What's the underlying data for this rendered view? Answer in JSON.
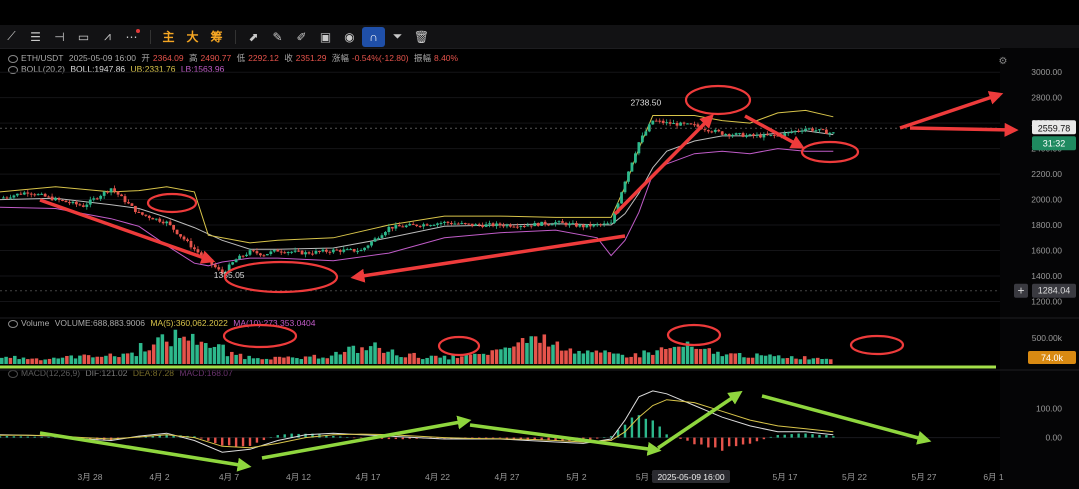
{
  "toolbar": {
    "items": [
      {
        "name": "trend-line-icon",
        "glyph": "⟋"
      },
      {
        "name": "parallel-lines-icon",
        "glyph": "☰"
      },
      {
        "name": "horizontal-line-icon",
        "glyph": "⊣"
      },
      {
        "name": "rectangle-icon",
        "glyph": "▭"
      },
      {
        "name": "fib-icon",
        "glyph": "⩘"
      },
      {
        "name": "more-icon",
        "glyph": "⋯"
      }
    ],
    "indicators": [
      "主",
      "大",
      "筹"
    ],
    "tools": [
      {
        "name": "pointer-icon",
        "glyph": "⬈"
      },
      {
        "name": "pencil-icon",
        "glyph": "✎"
      },
      {
        "name": "marker-icon",
        "glyph": "✐"
      },
      {
        "name": "clipboard-icon",
        "glyph": "▣"
      },
      {
        "name": "eye-icon",
        "glyph": "◉"
      },
      {
        "name": "magnet-icon",
        "glyph": "∩"
      },
      {
        "name": "filter-icon",
        "glyph": "⏷"
      },
      {
        "name": "trash-icon",
        "glyph": "🗑"
      }
    ]
  },
  "legend": {
    "symbol": "ETH/USDT",
    "datetime": "2025-05-09 16:00",
    "open_label": "开",
    "open": "2364.09",
    "high_label": "高",
    "high": "2490.77",
    "low_label": "低",
    "low": "2292.12",
    "close_label": "收",
    "close": "2351.29",
    "change_label": "涨幅",
    "change": "-0.54%(-12.80)",
    "amp_label": "振幅",
    "amp": "8.40%",
    "boll_name": "BOLL(20,2)",
    "boll": "BOLL:1947.86",
    "ub": "UB:2331.76",
    "lb": "LB:1563.96",
    "vol_name": "Volume",
    "vol": "VOLUME:688,883.9006",
    "ma5": "MA(5):360,062.2022",
    "ma10": "MA(10):273,353.0404",
    "macd_name": "MACD(12,26,9)",
    "dif": "DIF:121.02",
    "dea": "DEA:87.28",
    "macd": "MACD:168.07"
  },
  "colors": {
    "up": "#2db88c",
    "down": "#e5534b",
    "boll_mid": "#bbbbbb",
    "boll_ub": "#d8c44a",
    "boll_lb": "#c05cc8",
    "arrow_red": "#ee3b3b",
    "arrow_green": "#8fd63e",
    "vol_line": "#a4e04a"
  },
  "chart_data": [
    {
      "type": "line",
      "title": "ETH/USDT",
      "ylim": [
        1180,
        3080
      ],
      "y_ticks": [
        "3000.00",
        "2800.00",
        "2600.00",
        "2400.00",
        "2200.00",
        "2000.00",
        "1800.00",
        "1600.00",
        "1400.00",
        "1200.00"
      ],
      "y_tick_values": [
        3000,
        2800,
        2600,
        2400,
        2200,
        2000,
        1800,
        1600,
        1400,
        1200
      ],
      "x_ticks": [
        "3月 28",
        "4月 2",
        "4月 7",
        "4月 12",
        "4月 17",
        "4月 22",
        "4月 27",
        "5月 2",
        "5月 7",
        "5月 12",
        "5月 17",
        "5月 22",
        "5月 27",
        "6月 1"
      ],
      "series": [
        {
          "name": "price",
          "x": [
            0,
            2,
            4,
            6,
            8,
            10,
            12,
            14,
            16,
            17,
            18,
            19,
            20,
            22,
            24,
            26,
            28,
            30,
            32,
            34,
            36,
            38,
            40,
            42,
            44,
            45,
            46,
            47,
            48,
            50,
            52,
            54,
            56,
            58,
            60
          ],
          "values": [
            2010,
            2060,
            2000,
            1950,
            2090,
            1890,
            1820,
            1610,
            1420,
            1530,
            1590,
            1570,
            1600,
            1580,
            1600,
            1600,
            1780,
            1800,
            1820,
            1800,
            1800,
            1800,
            1820,
            1790,
            1810,
            2150,
            2450,
            2620,
            2600,
            2580,
            2520,
            2500,
            2500,
            2560,
            2520
          ]
        },
        {
          "name": "BOLL",
          "x": [
            0,
            4,
            8,
            10,
            12,
            14,
            16,
            18,
            20,
            24,
            28,
            32,
            36,
            40,
            44,
            45,
            46,
            47,
            48,
            50,
            52,
            54,
            56,
            58,
            60
          ],
          "values": [
            2000,
            2010,
            1960,
            1930,
            1860,
            1780,
            1680,
            1610,
            1610,
            1620,
            1700,
            1790,
            1800,
            1810,
            1800,
            1890,
            2050,
            2250,
            2380,
            2460,
            2500,
            2500,
            2520,
            2540,
            2510
          ]
        },
        {
          "name": "UB",
          "x": [
            0,
            4,
            8,
            10,
            12,
            14,
            15,
            16,
            18,
            20,
            24,
            28,
            32,
            36,
            40,
            44,
            45,
            46,
            47,
            48,
            50,
            52,
            54,
            56,
            58,
            60
          ],
          "values": [
            2060,
            2100,
            2060,
            2070,
            2100,
            2060,
            1720,
            1700,
            1660,
            1680,
            1700,
            1800,
            1870,
            1870,
            1860,
            1860,
            2100,
            2400,
            2660,
            2660,
            2660,
            2620,
            2600,
            2680,
            2700,
            2650
          ]
        },
        {
          "name": "LB",
          "x": [
            0,
            4,
            8,
            10,
            12,
            14,
            15,
            16,
            18,
            20,
            24,
            28,
            32,
            36,
            40,
            43,
            44,
            45,
            46,
            47,
            48,
            50,
            52,
            54,
            56,
            58,
            60
          ],
          "values": [
            1940,
            1930,
            1850,
            1790,
            1640,
            1500,
            1480,
            1510,
            1540,
            1540,
            1520,
            1580,
            1700,
            1740,
            1760,
            1700,
            1560,
            1680,
            1900,
            2200,
            2280,
            2360,
            2380,
            2360,
            2400,
            2380,
            2380
          ]
        }
      ],
      "annotations": [
        {
          "label": "2738.50",
          "x": 46.5,
          "y": 2738.5
        },
        {
          "label": "1385.05",
          "x": 16.5,
          "y": 1385.05
        }
      ],
      "price_tag": {
        "value": "2559.78",
        "timer": "31:32",
        "y": 2559.78
      },
      "hline_tag": {
        "value": "1284.04",
        "y": 1284.04
      }
    },
    {
      "type": "bar",
      "title": "Volume",
      "ylim": [
        0,
        700000
      ],
      "y_ticks": [
        "500.00k"
      ],
      "y_tick_values": [
        500000
      ],
      "values": [
        120,
        100,
        90,
        110,
        130,
        150,
        140,
        180,
        300,
        400,
        480,
        420,
        280,
        160,
        120,
        110,
        100,
        100,
        130,
        180,
        250,
        300,
        200,
        150,
        120,
        110,
        130,
        150,
        200,
        300,
        450,
        420,
        300,
        220,
        180,
        160,
        150,
        200,
        260,
        300,
        220,
        180,
        160,
        140,
        130,
        120,
        110,
        100
      ],
      "tag": {
        "value": "74.0k",
        "y": 74000
      }
    },
    {
      "type": "bar",
      "title": "MACD(12,26,9)",
      "ylim": [
        -70,
        170
      ],
      "y_ticks": [
        "100.00",
        "0.00"
      ],
      "y_tick_values": [
        100,
        0
      ],
      "x": [
        0,
        2,
        4,
        6,
        8,
        10,
        12,
        14,
        16,
        18,
        20,
        22,
        24,
        26,
        28,
        30,
        32,
        34,
        36,
        38,
        40,
        42,
        44,
        45,
        46,
        47,
        48,
        50,
        52,
        54,
        56,
        58,
        60
      ],
      "values": [
        5,
        4,
        2,
        -5,
        -8,
        2,
        10,
        5,
        -30,
        -25,
        10,
        15,
        5,
        -2,
        -6,
        -4,
        -3,
        -5,
        -2,
        -8,
        -10,
        -12,
        5,
        50,
        90,
        60,
        10,
        -20,
        -40,
        -20,
        10,
        15,
        5
      ],
      "dif": [
        10,
        8,
        5,
        -5,
        -10,
        5,
        15,
        -10,
        -50,
        -40,
        -10,
        10,
        15,
        10,
        5,
        0,
        -5,
        -5,
        -5,
        -10,
        -15,
        -20,
        -5,
        60,
        140,
        160,
        150,
        110,
        70,
        40,
        20,
        20,
        10
      ],
      "dea": [
        8,
        8,
        6,
        0,
        -5,
        2,
        10,
        0,
        -30,
        -35,
        -20,
        0,
        10,
        12,
        10,
        5,
        0,
        -3,
        -4,
        -6,
        -10,
        -15,
        -10,
        20,
        70,
        110,
        130,
        120,
        90,
        60,
        40,
        30,
        20
      ]
    }
  ]
}
